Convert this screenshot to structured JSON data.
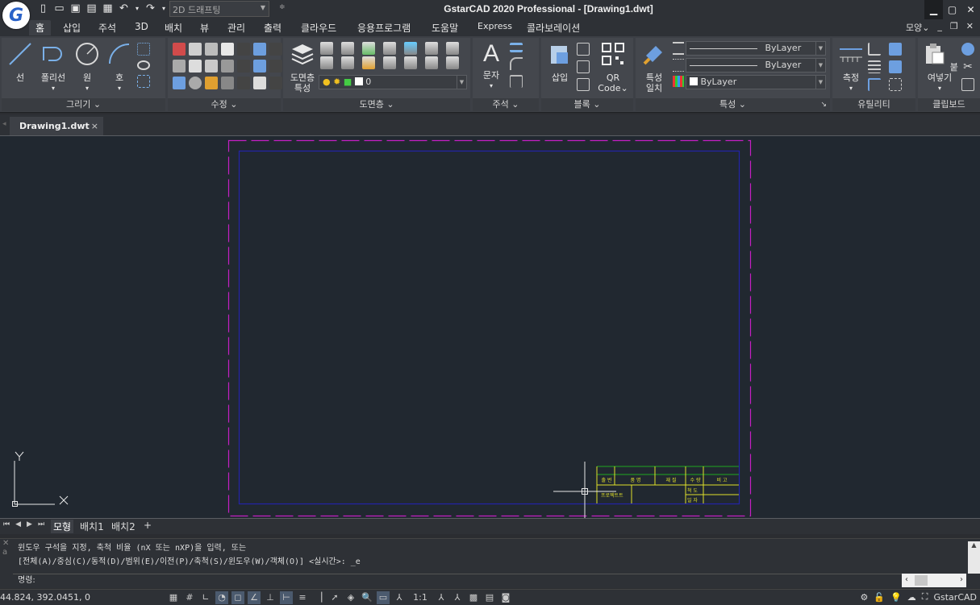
{
  "app": {
    "title": "GstarCAD 2020 Professional - [Drawing1.dwt]",
    "logo_letter": "G",
    "workspace": "2D 드래프팅"
  },
  "quick_access": [
    "new-icon",
    "open-icon",
    "save-icon",
    "save-as-icon",
    "print-icon",
    "undo-icon",
    "redo-icon"
  ],
  "menu": {
    "tabs": [
      "홈",
      "삽입",
      "주석",
      "3D",
      "배치",
      "뷰",
      "관리",
      "출력",
      "클라우드",
      "응용프로그램",
      "도움말",
      "Express",
      "콜라보레이션"
    ],
    "active": "홈",
    "style_label": "모양"
  },
  "ribbon": {
    "draw": {
      "label": "그리기",
      "line": "선",
      "polyline": "폴리선",
      "circle": "원",
      "arc": "호"
    },
    "modify": {
      "label": "수정"
    },
    "layers": {
      "label": "도면층",
      "properties_line1": "도면층",
      "properties_line2": "특성",
      "current_layer": "0"
    },
    "annotation": {
      "label": "주석",
      "text": "문자"
    },
    "block": {
      "label": "블록",
      "insert": "삽입",
      "qr_line1": "QR",
      "qr_line2": "Code"
    },
    "properties": {
      "label": "특성",
      "match_line1": "특성",
      "match_line2": "일치",
      "color": "ByLayer",
      "linetype": "ByLayer",
      "lineweight": "ByLayer"
    },
    "utilities": {
      "label": "유틸리티",
      "measure": "측정"
    },
    "clipboard": {
      "label": "클립보드",
      "paste": "붙여넣기"
    }
  },
  "document_tab": {
    "name": "Drawing1.dwt",
    "close": "×"
  },
  "title_block": {
    "row1": [
      "출 번",
      "품 명",
      "재 질",
      "수 량",
      "비 고"
    ],
    "row2_left": "프로젝트트",
    "row2_right": [
      "척 도",
      "일 자"
    ]
  },
  "layout_tabs": [
    "모형",
    "배치1",
    "배치2",
    "+"
  ],
  "command": {
    "history_line1": "윈도우 구석을 지정, 축척 비율 (nX 또는 nXP)을 입력, 또는",
    "history_line2": "[전체(A)/중심(C)/동적(D)/범위(E)/이전(P)/축척(S)/윈도우(W)/객체(O)] <실시간>: _e",
    "prompt": "명령:"
  },
  "status": {
    "coords": "44.824, 392.0451, 0",
    "scale": "1:1",
    "app_name": "GstarCAD"
  },
  "colors": {
    "canvas": "#212830",
    "paper_border": "#c41fc4",
    "margin_border": "#2323a8",
    "titleblock_green": "#1fa81f",
    "titleblock_yellow": "#e0e02a"
  }
}
